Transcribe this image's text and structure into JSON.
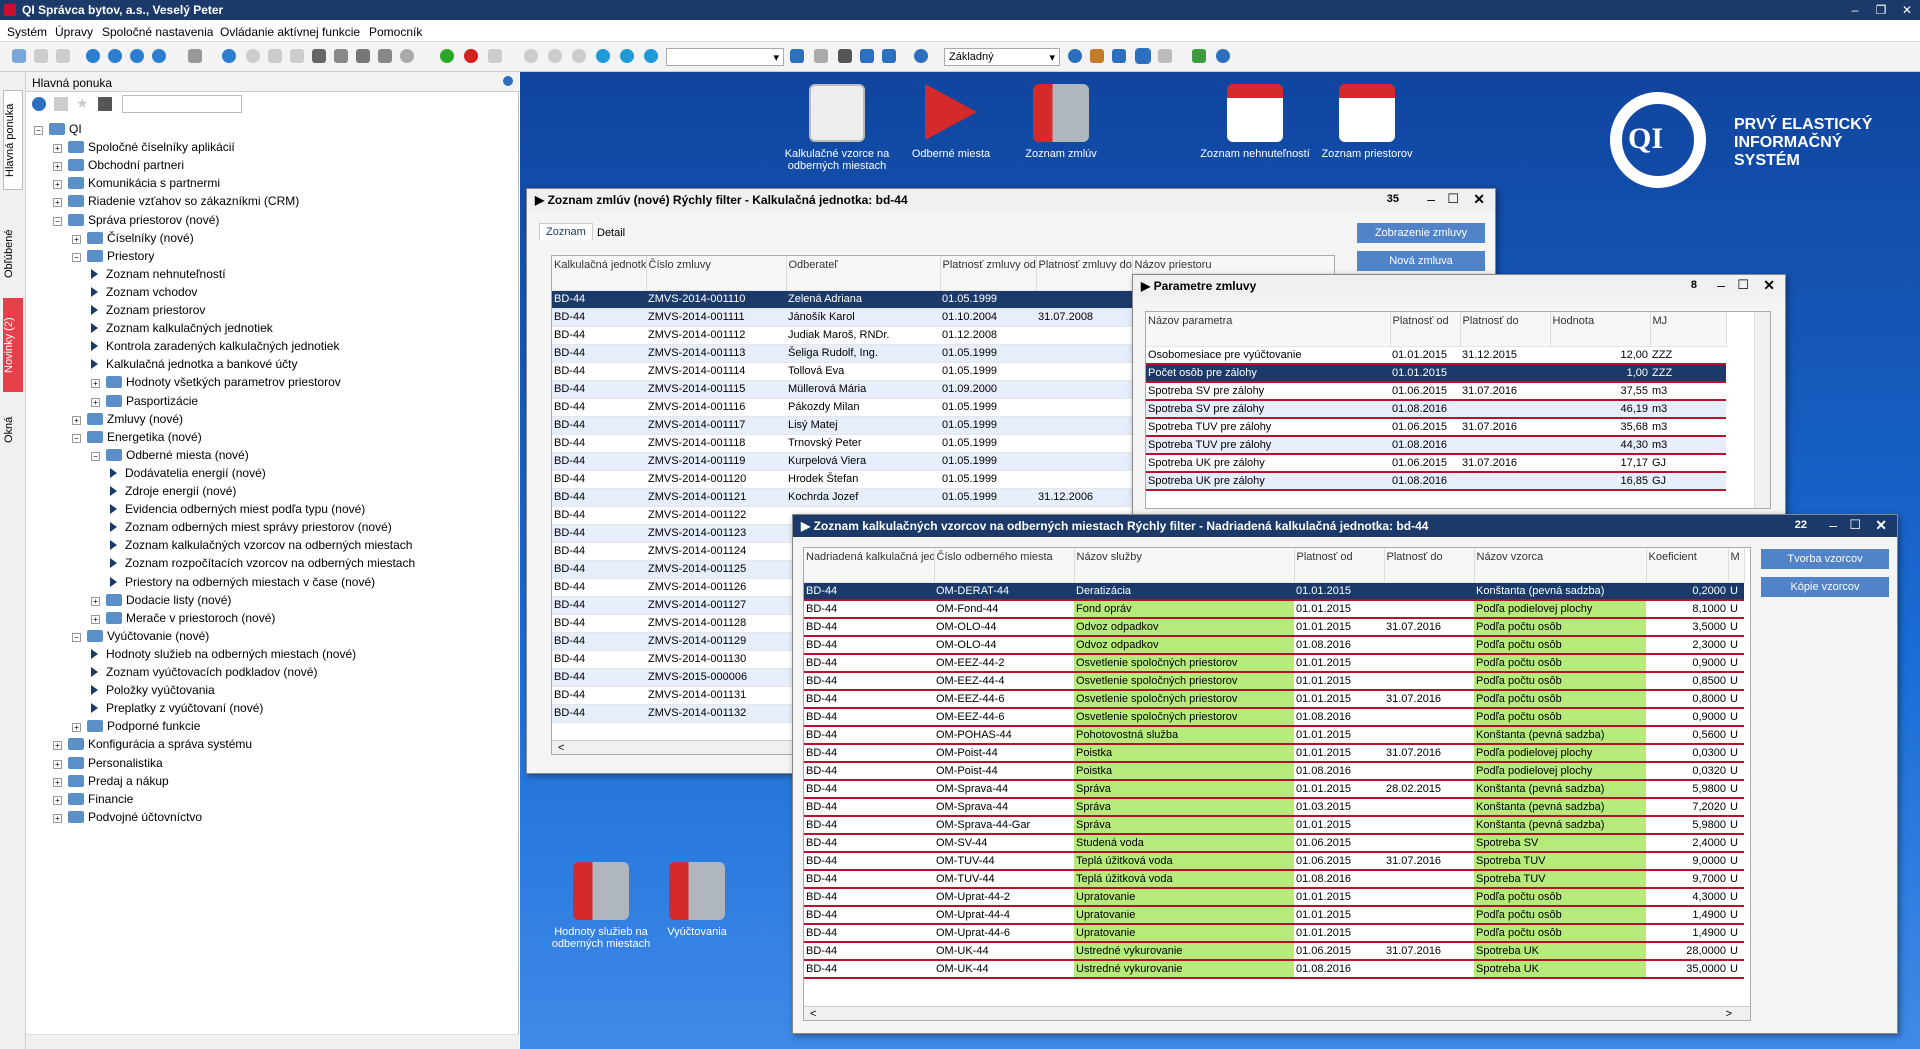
{
  "app": {
    "title": "QI Správca bytov, a.s., Veselý Peter"
  },
  "menu": [
    "Systém",
    "Úpravy",
    "Spoločné nastavenia",
    "Ovládanie aktívnej funkcie",
    "Pomocník"
  ],
  "toolbar": {
    "view_combo": "Základný"
  },
  "lefttabs": [
    "Hlavná ponuka",
    "Obľúbené",
    "Novinky (2)",
    "Okná"
  ],
  "nav": {
    "title": "Hlavná ponuka",
    "tree": [
      {
        "l": 0,
        "k": "folder",
        "t": "QI",
        "pm": "−"
      },
      {
        "l": 1,
        "k": "folder",
        "t": "Spoločné číselníky aplikácií",
        "pm": "+"
      },
      {
        "l": 1,
        "k": "folder",
        "t": "Obchodní partneri",
        "pm": "+"
      },
      {
        "l": 1,
        "k": "folder",
        "t": "Komunikácia s partnermi",
        "pm": "+"
      },
      {
        "l": 1,
        "k": "folder",
        "t": "Riadenie vzťahov so zákazníkmi (CRM)",
        "pm": "+"
      },
      {
        "l": 1,
        "k": "folder",
        "t": "Správa priestorov (nové)",
        "pm": "−"
      },
      {
        "l": 2,
        "k": "folder",
        "t": "Číselníky (nové)",
        "pm": "+"
      },
      {
        "l": 2,
        "k": "folder",
        "t": "Priestory",
        "pm": "−"
      },
      {
        "l": 3,
        "k": "item",
        "t": "Zoznam nehnuteľností"
      },
      {
        "l": 3,
        "k": "item",
        "t": "Zoznam vchodov"
      },
      {
        "l": 3,
        "k": "item",
        "t": "Zoznam priestorov"
      },
      {
        "l": 3,
        "k": "item",
        "t": "Zoznam kalkulačných jednotiek"
      },
      {
        "l": 3,
        "k": "item",
        "t": "Kontrola zaradených kalkulačných jednotiek"
      },
      {
        "l": 3,
        "k": "item",
        "t": "Kalkulačná jednotka a bankové účty"
      },
      {
        "l": 3,
        "k": "folder",
        "t": "Hodnoty všetkých parametrov priestorov",
        "pm": "+"
      },
      {
        "l": 3,
        "k": "folder",
        "t": "Pasportizácie",
        "pm": "+"
      },
      {
        "l": 2,
        "k": "folder",
        "t": "Zmluvy (nové)",
        "pm": "+"
      },
      {
        "l": 2,
        "k": "folder",
        "t": "Energetika (nové)",
        "pm": "−"
      },
      {
        "l": 3,
        "k": "folder",
        "t": "Odberné miesta (nové)",
        "pm": "−"
      },
      {
        "l": 4,
        "k": "item",
        "t": "Dodávatelia energií (nové)"
      },
      {
        "l": 4,
        "k": "item",
        "t": "Zdroje energií (nové)"
      },
      {
        "l": 4,
        "k": "item",
        "t": "Evidencia odberných miest podľa typu (nové)"
      },
      {
        "l": 4,
        "k": "item",
        "t": "Zoznam odberných miest správy priestorov (nové)"
      },
      {
        "l": 4,
        "k": "item",
        "t": "Zoznam kalkulačných vzorcov na odberných miestach"
      },
      {
        "l": 4,
        "k": "item",
        "t": "Zoznam rozpočítacích vzorcov na odberných miestach"
      },
      {
        "l": 4,
        "k": "item",
        "t": "Priestory na odberných miestach v čase (nové)"
      },
      {
        "l": 3,
        "k": "folder",
        "t": "Dodacie listy (nové)",
        "pm": "+"
      },
      {
        "l": 3,
        "k": "folder",
        "t": "Merače v priestoroch (nové)",
        "pm": "+"
      },
      {
        "l": 2,
        "k": "folder",
        "t": "Vyúčtovanie (nové)",
        "pm": "−"
      },
      {
        "l": 3,
        "k": "item",
        "t": "Hodnoty služieb na odberných miestach (nové)"
      },
      {
        "l": 3,
        "k": "item",
        "t": "Zoznam vyúčtovacích podkladov (nové)"
      },
      {
        "l": 3,
        "k": "item",
        "t": "Položky vyúčtovania"
      },
      {
        "l": 3,
        "k": "item",
        "t": "Preplatky z vyúčtovaní (nové)"
      },
      {
        "l": 2,
        "k": "folder",
        "t": "Podporné funkcie",
        "pm": "+"
      },
      {
        "l": 1,
        "k": "folder",
        "t": "Konfigurácia a správa systému",
        "pm": "+"
      },
      {
        "l": 1,
        "k": "folder",
        "t": "Personalistika",
        "pm": "+"
      },
      {
        "l": 1,
        "k": "folder",
        "t": "Predaj a nákup",
        "pm": "+"
      },
      {
        "l": 1,
        "k": "folder",
        "t": "Financie",
        "pm": "+"
      },
      {
        "l": 1,
        "k": "folder",
        "t": "Podvojné účtovníctvo",
        "pm": "+"
      }
    ]
  },
  "desktop": {
    "icons": [
      {
        "label": "Kalkulačné vzorce na odberných miestach",
        "color": "#ddd"
      },
      {
        "label": "Odberné miesta",
        "color": "#d42a2a"
      },
      {
        "label": "Zoznam zmlúv",
        "color": "#b0b6be"
      },
      {
        "label": "Zoznam nehnuteľností",
        "color": "#d42a2a"
      },
      {
        "label": "Zoznam priestorov",
        "color": "#d42a2a"
      }
    ],
    "bottom_icons": [
      {
        "label": "Hodnoty služieb na odberných miestach"
      },
      {
        "label": "Vyúčtovania"
      }
    ],
    "brand": [
      "PRVÝ ELASTICKÝ",
      "INFORMAČNÝ",
      "SYSTÉM"
    ],
    "brand_logo": "QI"
  },
  "zmluvy": {
    "title": "Zoznam zmlúv (nové)   Rýchly filter -   Kalkulačná jednotka: bd-44",
    "count": "35",
    "tabs": [
      "Zoznam",
      "Detail"
    ],
    "buttons": [
      "Zobrazenie zmluvy",
      "Nová zmluva"
    ],
    "cols": [
      "Kalkulačná jednotka",
      "Číslo zmluvy",
      "Odberateľ",
      "Platnosť zmluvy od",
      "Platnosť zmluvy do",
      "Názov priestoru"
    ],
    "rows": [
      [
        "BD-44",
        "ZMVS-2014-001110",
        "Zelená Adriana",
        "01.05.1999",
        ""
      ],
      [
        "BD-44",
        "ZMVS-2014-001111",
        "Jánošík Karol",
        "01.10.2004",
        "31.07.2008"
      ],
      [
        "BD-44",
        "ZMVS-2014-001112",
        "Judiak Maroš, RNDr.",
        "01.12.2008",
        ""
      ],
      [
        "BD-44",
        "ZMVS-2014-001113",
        "Šeliga Rudolf, Ing.",
        "01.05.1999",
        ""
      ],
      [
        "BD-44",
        "ZMVS-2014-001114",
        "Tollová Eva",
        "01.05.1999",
        ""
      ],
      [
        "BD-44",
        "ZMVS-2014-001115",
        "Müllerová Mária",
        "01.09.2000",
        ""
      ],
      [
        "BD-44",
        "ZMVS-2014-001116",
        "Pákozdy Milan",
        "01.05.1999",
        ""
      ],
      [
        "BD-44",
        "ZMVS-2014-001117",
        "Lisý Matej",
        "01.05.1999",
        ""
      ],
      [
        "BD-44",
        "ZMVS-2014-001118",
        "Trnovský Peter",
        "01.05.1999",
        ""
      ],
      [
        "BD-44",
        "ZMVS-2014-001119",
        "Kurpelová Viera",
        "01.05.1999",
        ""
      ],
      [
        "BD-44",
        "ZMVS-2014-001120",
        "Hrodek Štefan",
        "01.05.1999",
        ""
      ],
      [
        "BD-44",
        "ZMVS-2014-001121",
        "Kochrda Jozef",
        "01.05.1999",
        "31.12.2006"
      ],
      [
        "BD-44",
        "ZMVS-2014-001122",
        "",
        "",
        " "
      ],
      [
        "BD-44",
        "ZMVS-2014-001123",
        "",
        "",
        ""
      ],
      [
        "BD-44",
        "ZMVS-2014-001124",
        "",
        "",
        ""
      ],
      [
        "BD-44",
        "ZMVS-2014-001125",
        "",
        "",
        ""
      ],
      [
        "BD-44",
        "ZMVS-2014-001126",
        "",
        "",
        ""
      ],
      [
        "BD-44",
        "ZMVS-2014-001127",
        "",
        "",
        ""
      ],
      [
        "BD-44",
        "ZMVS-2014-001128",
        "",
        "",
        ""
      ],
      [
        "BD-44",
        "ZMVS-2014-001129",
        "",
        "",
        ""
      ],
      [
        "BD-44",
        "ZMVS-2014-001130",
        "",
        "",
        ""
      ],
      [
        "BD-44",
        "ZMVS-2015-000006",
        "",
        "",
        ""
      ],
      [
        "BD-44",
        "ZMVS-2014-001131",
        "",
        "",
        ""
      ],
      [
        "BD-44",
        "ZMVS-2014-001132",
        "",
        "",
        ""
      ]
    ]
  },
  "parametre": {
    "title": "Parametre zmluvy",
    "count": "8",
    "cols": [
      "Názov parametra",
      "Platnosť od",
      "Platnosť do",
      "Hodnota",
      "MJ"
    ],
    "rows": [
      [
        "Osobomesiace pre vyúčtovanie",
        "01.01.2015",
        "31.12.2015",
        "12,00",
        "ZZZ"
      ],
      [
        "Počet osôb pre zálohy",
        "01.01.2015",
        "",
        "1,00",
        "ZZZ"
      ],
      [
        "Spotreba SV pre zálohy",
        "01.06.2015",
        "31.07.2016",
        "37,55",
        "m3"
      ],
      [
        "Spotreba SV pre zálohy",
        "01.08.2016",
        "",
        "46,19",
        "m3"
      ],
      [
        "Spotreba TUV pre zálohy",
        "01.06.2015",
        "31.07.2016",
        "35,68",
        "m3"
      ],
      [
        "Spotreba TUV pre zálohy",
        "01.08.2016",
        "",
        "44,30",
        "m3"
      ],
      [
        "Spotreba UK pre zálohy",
        "01.06.2015",
        "31.07.2016",
        "17,17",
        "GJ"
      ],
      [
        "Spotreba UK pre zálohy",
        "01.08.2016",
        "",
        "16,85",
        "GJ"
      ]
    ]
  },
  "vzorce": {
    "title": "Zoznam kalkulačných vzorcov na odberných miestach   Rýchly filter -   Nadriadená kalkulačná jednotka: bd-44",
    "count": "22",
    "buttons": [
      "Tvorba vzorcov",
      "Kópie vzorcov"
    ],
    "cols": [
      "Nadriadená kalkulačná jednotka",
      "Číslo odberného miesta",
      "Názov služby",
      "Platnosť od",
      "Platnosť do",
      "Názov vzorca",
      "Koeficient",
      "M"
    ],
    "rows": [
      [
        "BD-44",
        "OM-DERAT-44",
        "Deratizácia",
        "01.01.2015",
        "",
        "Konštanta (pevná sadzba)",
        "0,2000",
        "U"
      ],
      [
        "BD-44",
        "OM-Fond-44",
        "Fond opráv",
        "01.01.2015",
        "",
        "Podľa podielovej plochy",
        "8,1000",
        "U"
      ],
      [
        "BD-44",
        "OM-OLO-44",
        "Odvoz odpadkov",
        "01.01.2015",
        "31.07.2016",
        "Podľa počtu osôb",
        "3,5000",
        "U"
      ],
      [
        "BD-44",
        "OM-OLO-44",
        "Odvoz odpadkov",
        "01.08.2016",
        "",
        "Podľa počtu osôb",
        "2,3000",
        "U"
      ],
      [
        "BD-44",
        "OM-EEZ-44-2",
        "Osvetlenie spoločných priestorov",
        "01.01.2015",
        "",
        "Podľa počtu osôb",
        "0,9000",
        "U"
      ],
      [
        "BD-44",
        "OM-EEZ-44-4",
        "Osvetlenie spoločných priestorov",
        "01.01.2015",
        "",
        "Podľa počtu osôb",
        "0,8500",
        "U"
      ],
      [
        "BD-44",
        "OM-EEZ-44-6",
        "Osvetlenie spoločných priestorov",
        "01.01.2015",
        "31.07.2016",
        "Podľa počtu osôb",
        "0,8000",
        "U"
      ],
      [
        "BD-44",
        "OM-EEZ-44-6",
        "Osvetlenie spoločných priestorov",
        "01.08.2016",
        "",
        "Podľa počtu osôb",
        "0,9000",
        "U"
      ],
      [
        "BD-44",
        "OM-POHAS-44",
        "Pohotovostná služba",
        "01.01.2015",
        "",
        "Konštanta (pevná sadzba)",
        "0,5600",
        "U"
      ],
      [
        "BD-44",
        "OM-Poist-44",
        "Poistka",
        "01.01.2015",
        "31.07.2016",
        "Podľa podielovej plochy",
        "0,0300",
        "U"
      ],
      [
        "BD-44",
        "OM-Poist-44",
        "Poistka",
        "01.08.2016",
        "",
        "Podľa podielovej plochy",
        "0,0320",
        "U"
      ],
      [
        "BD-44",
        "OM-Sprava-44",
        "Správa",
        "01.01.2015",
        "28.02.2015",
        "Konštanta (pevná sadzba)",
        "5,9800",
        "U"
      ],
      [
        "BD-44",
        "OM-Sprava-44",
        "Správa",
        "01.03.2015",
        "",
        "Konštanta (pevná sadzba)",
        "7,2020",
        "U"
      ],
      [
        "BD-44",
        "OM-Sprava-44-Gar",
        "Správa",
        "01.01.2015",
        "",
        "Konštanta (pevná sadzba)",
        "5,9800",
        "U"
      ],
      [
        "BD-44",
        "OM-SV-44",
        "Studená voda",
        "01.06.2015",
        "",
        "Spotreba SV",
        "2,4000",
        "U"
      ],
      [
        "BD-44",
        "OM-TUV-44",
        "Teplá úžitková voda",
        "01.06.2015",
        "31.07.2016",
        "Spotreba TUV",
        "9,0000",
        "U"
      ],
      [
        "BD-44",
        "OM-TUV-44",
        "Teplá úžitková voda",
        "01.08.2016",
        "",
        "Spotreba TUV",
        "9,7000",
        "U"
      ],
      [
        "BD-44",
        "OM-Uprat-44-2",
        "Upratovanie",
        "01.01.2015",
        "",
        "Podľa počtu osôb",
        "4,3000",
        "U"
      ],
      [
        "BD-44",
        "OM-Uprat-44-4",
        "Upratovanie",
        "01.01.2015",
        "",
        "Podľa počtu osôb",
        "1,4900",
        "U"
      ],
      [
        "BD-44",
        "OM-Uprat-44-6",
        "Upratovanie",
        "01.01.2015",
        "",
        "Podľa počtu osôb",
        "1,4900",
        "U"
      ],
      [
        "BD-44",
        "OM-UK-44",
        "Ustredné vykurovanie",
        "01.06.2015",
        "31.07.2016",
        "Spotreba UK",
        "28,0000",
        "U"
      ],
      [
        "BD-44",
        "OM-UK-44",
        "Ustredné vykurovanie",
        "01.08.2016",
        "",
        "Spotreba UK",
        "35,0000",
        "U"
      ]
    ]
  }
}
